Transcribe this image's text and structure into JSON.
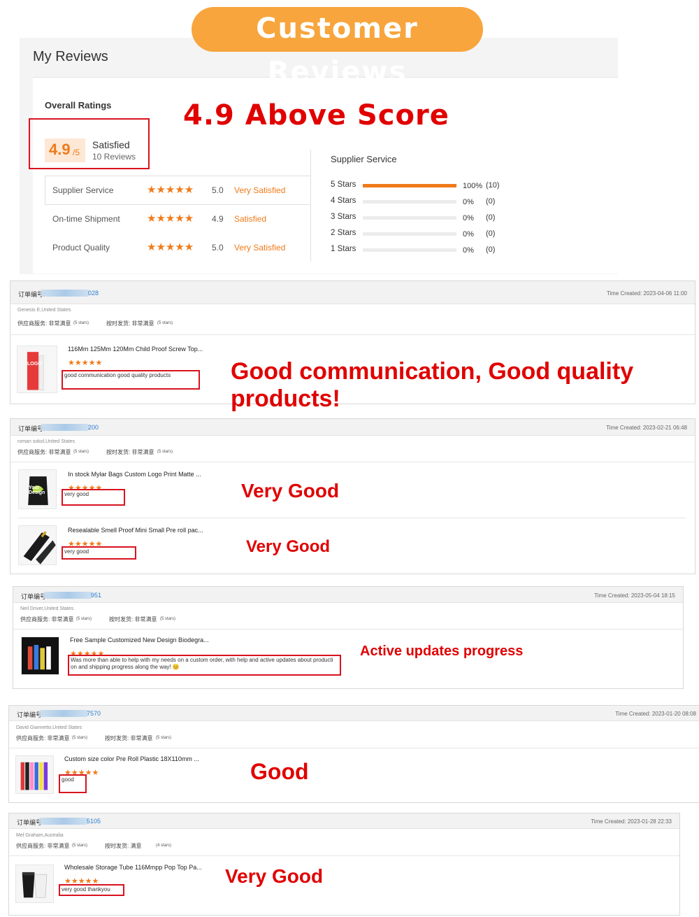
{
  "banner": {
    "title": "Customer Reviews"
  },
  "header": {
    "title": "My Reviews"
  },
  "overall": {
    "label": "Overall Ratings",
    "score": "4.9",
    "denominator": "/5",
    "satisfaction": "Satisfied",
    "reviews": "10 Reviews",
    "highlight": "4.9 Above Score"
  },
  "categories": [
    {
      "name": "Supplier Service",
      "stars": "★★★★★",
      "score": "5.0",
      "satisfaction": "Very Satisfied"
    },
    {
      "name": "On-time Shipment",
      "stars": "★★★★★",
      "score": "4.9",
      "satisfaction": "Satisfied"
    },
    {
      "name": "Product Quality",
      "stars": "★★★★★",
      "score": "5.0",
      "satisfaction": "Very Satisfied"
    }
  ],
  "supplier_service": {
    "title": "Supplier Service",
    "rows": [
      {
        "label": "5 Stars",
        "percent": "100%",
        "count": "(10)",
        "fraction": 1.0
      },
      {
        "label": "4 Stars",
        "percent": "0%",
        "count": "(0)",
        "fraction": 0
      },
      {
        "label": "3 Stars",
        "percent": "0%",
        "count": "(0)",
        "fraction": 0
      },
      {
        "label": "2 Stars",
        "percent": "0%",
        "count": "(0)",
        "fraction": 0
      },
      {
        "label": "1 Stars",
        "percent": "0%",
        "count": "(0)",
        "fraction": 0
      }
    ]
  },
  "orders": [
    {
      "order_label": "订单编号:",
      "order_tail": "028",
      "time": "Time Created: 2023-04-06 11:00",
      "buyer": "Genesis E,United States",
      "svc": "供应商服务: 非常满意",
      "svc_stars": "(5 stars)",
      "ship": "按时发货: 非常满意",
      "ship_stars": "(5 stars)",
      "products": [
        {
          "title": "116Mm 125Mm 120Mm Child Proof Screw Top...",
          "stars": "★★★★★",
          "comment": "good communication good quality products",
          "callout": "Good communication, Good quality products!",
          "thumb_text": "LOGO"
        }
      ]
    },
    {
      "order_label": "订单编号:",
      "order_tail": "200",
      "time": "Time Created: 2023-02-21 06:48",
      "buyer": "roman sokol,United States",
      "svc": "供应商服务: 非常满意",
      "svc_stars": "(5 stars)",
      "ship": "按时发货: 非常满意",
      "ship_stars": "(5 stars)",
      "products": [
        {
          "title": "In stock Mylar Bags Custom Logo Print Matte ...",
          "stars": "★★★★★",
          "comment": "very good",
          "callout": "Very Good",
          "thumb_text": "Your Design"
        },
        {
          "title": "Resealable Smell Proof Mini Small Pre roll pac...",
          "stars": "★★★★★",
          "comment": "very good",
          "callout": "Very Good",
          "thumb_text": ""
        }
      ]
    },
    {
      "order_label": "订单编号:",
      "order_tail": "951",
      "time": "Time Created: 2023-05-04 18:15",
      "buyer": "Neil Driver,United States",
      "svc": "供应商服务: 非常满意",
      "svc_stars": "(5 stars)",
      "ship": "按时发货: 非常满意",
      "ship_stars": "(5 stars)",
      "products": [
        {
          "title": "Free Sample Customized New Design Biodegra...",
          "stars": "★★★★★",
          "comment": "Was more than able to help with my needs on a custom order,  with help and active updates about producti on and shipping progress along the way! 😊",
          "callout": "Active updates progress",
          "thumb_text": ""
        }
      ]
    },
    {
      "order_label": "订单编号:",
      "order_tail": "7570",
      "time": "Time Created: 2023-01-20 08:08",
      "buyer": "David Giannetto,United States",
      "svc": "供应商服务: 非常满意",
      "svc_stars": "(5 stars)",
      "ship": "按时发货: 非常满意",
      "ship_stars": "(5 stars)",
      "products": [
        {
          "title": "Custom size color Pre Roll Plastic 18X110mm ...",
          "stars": "★★★★★",
          "comment": "good",
          "callout": "Good",
          "thumb_text": ""
        }
      ]
    },
    {
      "order_label": "订单编号",
      "order_tail": "5105",
      "time": "Time Created: 2023-01-28 22:33",
      "buyer": "Mel Graham,Australia",
      "svc": "供应商服务: 非常满意",
      "svc_stars": "(5 stars)",
      "ship": "按时发货: 满意",
      "ship_stars": "(4 stars)",
      "products": [
        {
          "title": "Wholesale Storage Tube 116Mmpp Pop Top Pa...",
          "stars": "★★★★★",
          "comment": "very good thankyou",
          "callout": "Very Good",
          "thumb_text": ""
        }
      ]
    }
  ],
  "colors": {
    "accent": "#f07a19",
    "banner": "#f7a53c",
    "highlight_red": "#e00000",
    "box_red": "#d8131f"
  }
}
